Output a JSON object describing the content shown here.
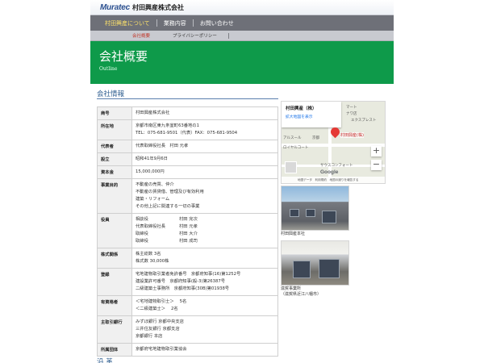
{
  "header": {
    "logo_mark": "Muratec",
    "company_name": "村田興産株式会社"
  },
  "nav": {
    "items": [
      {
        "label": "村田興産について",
        "active": true
      },
      {
        "label": "業務内容",
        "active": false
      },
      {
        "label": "お問い合わせ",
        "active": false
      }
    ]
  },
  "subnav": {
    "items": [
      {
        "label": "会社概要",
        "active": true
      },
      {
        "label": "プライバシーポリシー",
        "active": false
      }
    ]
  },
  "hero": {
    "title": "会社概要",
    "subtitle": "Outline"
  },
  "section": {
    "title": "会社情報"
  },
  "company_info": {
    "rows": [
      {
        "label": "商号",
        "lines": [
          "村田興産株式会社"
        ]
      },
      {
        "label": "所在地",
        "lines": [
          "京都市南区東九条室町63番地の1",
          "TEL：075-681-9501（代表）FAX：075-681-9504"
        ]
      },
      {
        "label": "代表者",
        "lines": [
          "代表取締役社長　村田 元孝"
        ]
      },
      {
        "label": "設立",
        "lines": [
          "昭和41年9月6日"
        ]
      },
      {
        "label": "資本金",
        "lines": [
          "15,000,000円"
        ]
      },
      {
        "label": "事業目的",
        "lines": [
          "不動産の売買、仲介",
          "不動産の賃貸借、管理及び有効利用",
          "建築・リフォーム",
          "その他上記に関連する一切の事業"
        ]
      },
      {
        "label": "役員",
        "pairs": [
          [
            "相談役",
            "村田 完次"
          ],
          [
            "代表取締役社長",
            "村田 元孝"
          ],
          [
            "取締役",
            "村田 大介"
          ],
          [
            "取締役",
            "村田 成司"
          ]
        ]
      },
      {
        "label": "株式関係",
        "lines": [
          "株主総数 3名",
          "株式数 30,000株"
        ]
      },
      {
        "label": "登録",
        "lines": [
          "宅地建物取引業者免許番号　京都府知事(16)第1252号",
          "建設業許可番号　京都府知事(般-3)第26387号",
          "二級建築士事務所　京都府知事(30B)第01938号"
        ]
      },
      {
        "label": "有資格者",
        "lines": [
          "＜宅地建物取引士＞　 5名",
          "＜二級建築士＞　 2名"
        ]
      },
      {
        "label": "主取引銀行",
        "lines": [
          "みずほ銀行 京都中央支店",
          "三井住友銀行 京都支店",
          "京都銀行 本店"
        ]
      },
      {
        "label": "所属団体",
        "lines": [
          "京都府宅地建物取引業協会"
        ]
      }
    ]
  },
  "map": {
    "place_name": "村田興産（株）",
    "link": "拡大地図を表示",
    "pin_label": "村田興産(株)",
    "labels": [
      "マート",
      "ナワ店",
      "アルスール",
      "ロイヤルコート",
      "サウスコンフォート",
      "エクスプレスト",
      "京都"
    ],
    "google": "Google",
    "footer": "地図データ　利用規約　地図の誤りを報告する",
    "zoom_in": "+",
    "zoom_out": "−"
  },
  "photos": [
    {
      "caption": "村田興産本社"
    },
    {
      "caption_lines": [
        "滋賀事業所",
        "（滋賀県近江八幡市）"
      ]
    }
  ],
  "next_section": {
    "title": "沿 革"
  }
}
